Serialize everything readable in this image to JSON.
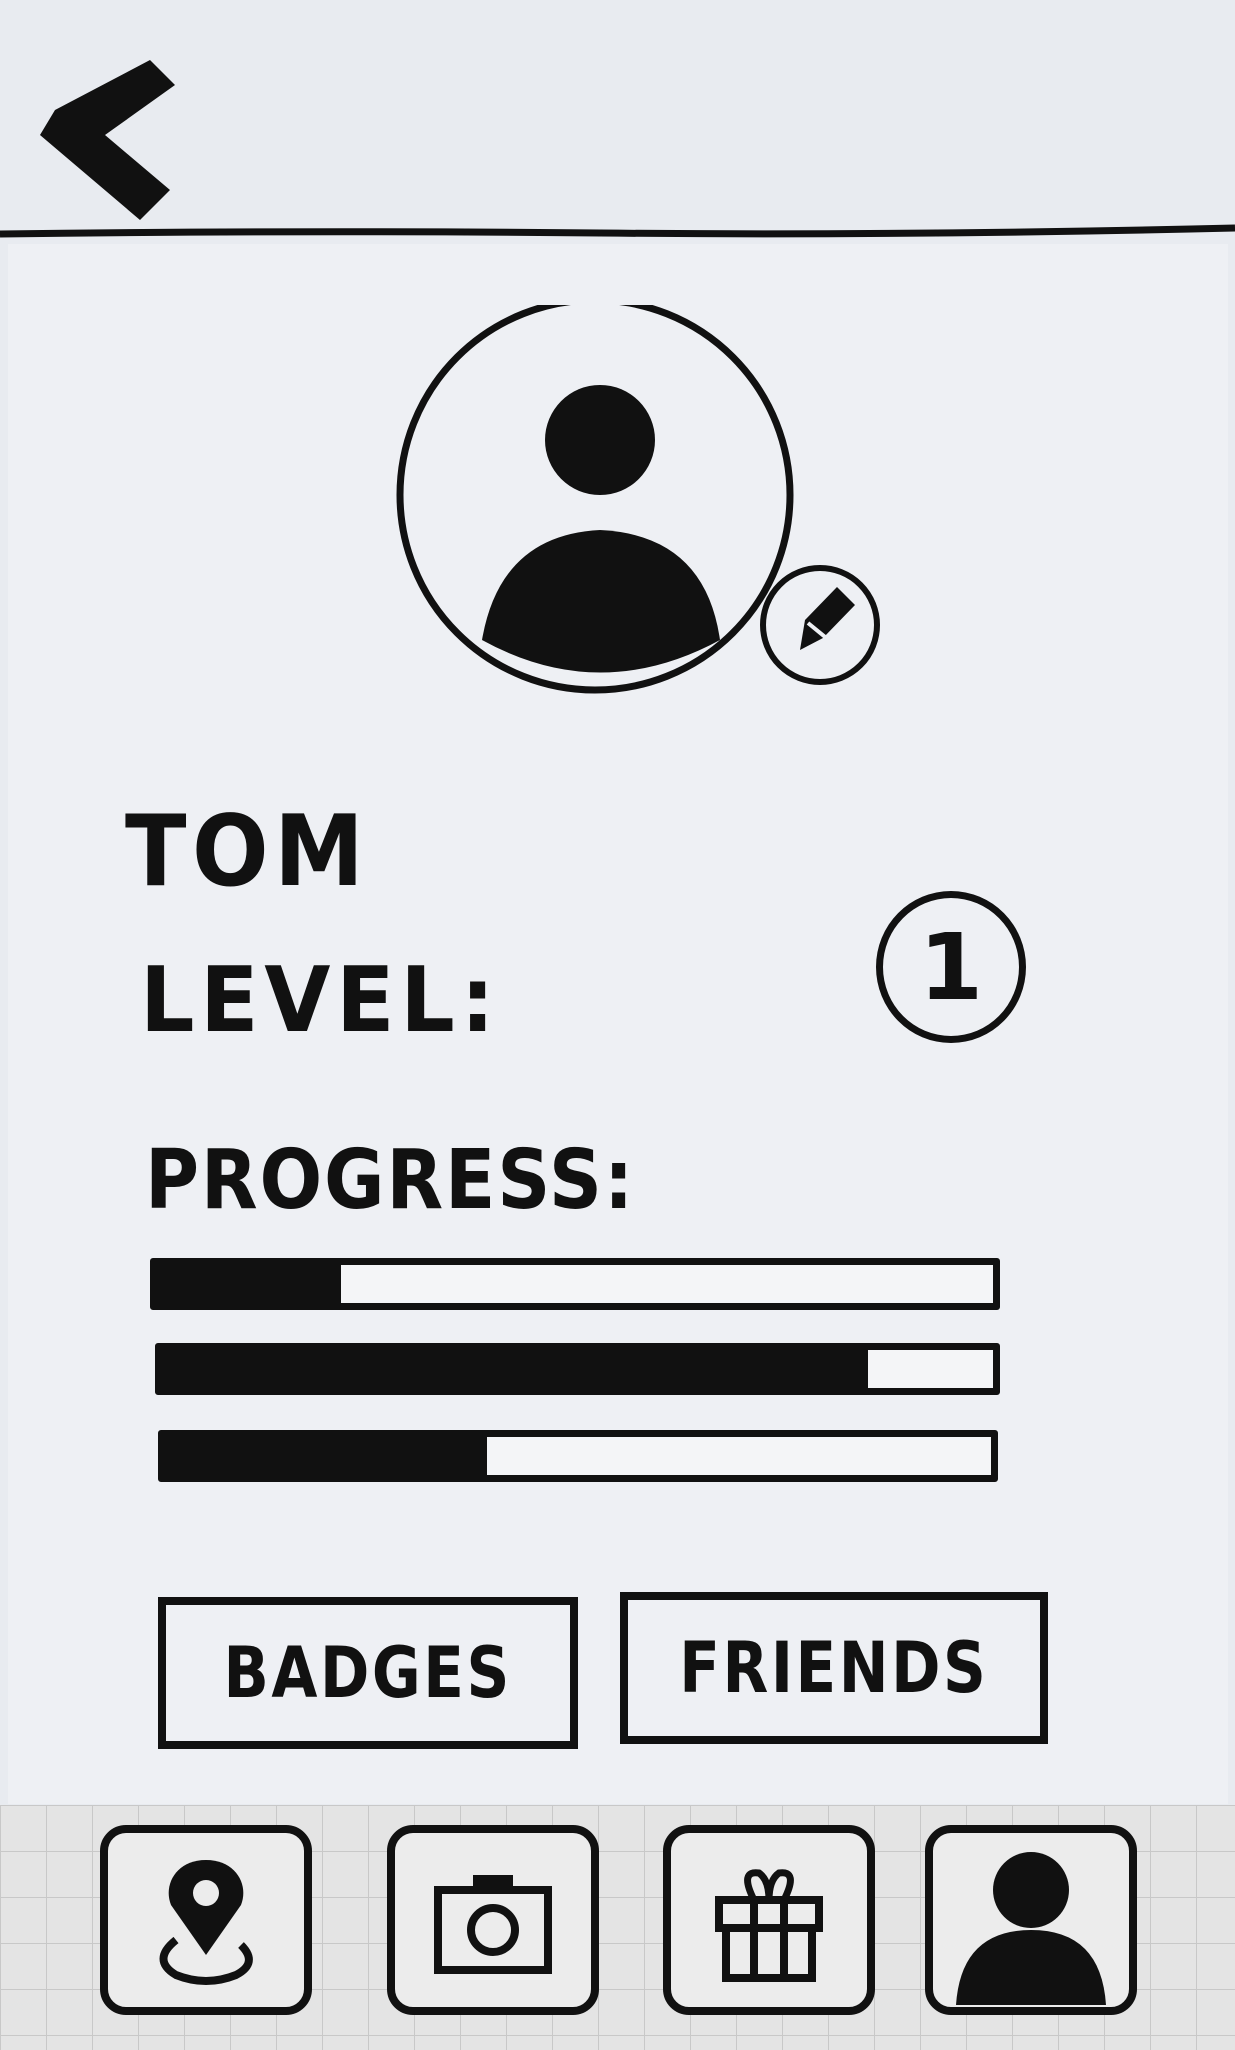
{
  "profile": {
    "name": "TOM",
    "level_label": "LEVEL:",
    "level_value": "1",
    "progress_label": "PROGRESS:",
    "progress_bars": [
      {
        "fraction": 0.22
      },
      {
        "fraction": 0.85
      },
      {
        "fraction": 0.39
      }
    ]
  },
  "actions": {
    "badges_label": "BADGES",
    "friends_label": "FRIENDS"
  },
  "icons": {
    "back": "chevron-left-icon",
    "avatar": "user-avatar-icon",
    "edit": "pencil-icon",
    "tabs": [
      "map-pin-icon",
      "camera-icon",
      "gift-icon",
      "user-icon"
    ]
  },
  "colors": {
    "ink": "#111111",
    "paper": "#eef0f4"
  }
}
